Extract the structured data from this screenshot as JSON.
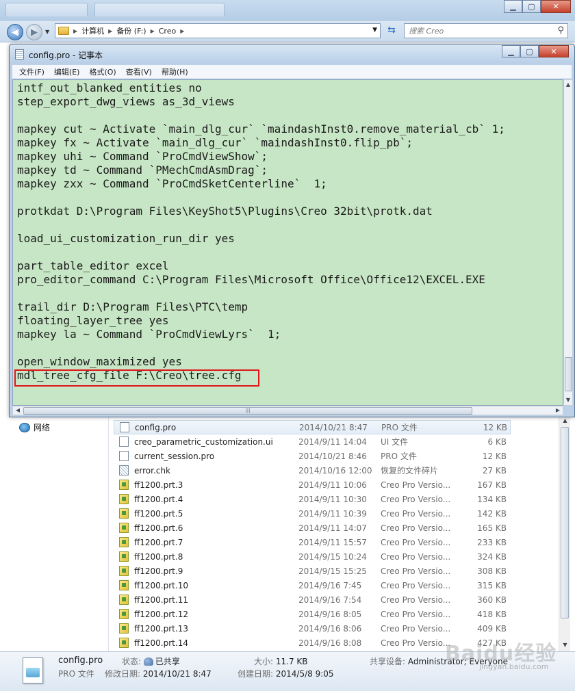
{
  "explorer": {
    "address": [
      "计算机",
      "备份 (F:)",
      "Creo"
    ],
    "search_placeholder": "搜索 Creo"
  },
  "notepad": {
    "title": "config.pro - 记事本",
    "menu": [
      "文件(F)",
      "编辑(E)",
      "格式(O)",
      "查看(V)",
      "帮助(H)"
    ],
    "content": "intf_out_blanked_entities no\nstep_export_dwg_views as_3d_views\n\nmapkey cut ~ Activate `main_dlg_cur` `maindashInst0.remove_material_cb` 1;\nmapkey fx ~ Activate `main_dlg_cur` `maindashInst0.flip_pb`;\nmapkey uhi ~ Command `ProCmdViewShow`;\nmapkey td ~ Command `PMechCmdAsmDrag`;\nmapkey zxx ~ Command `ProCmdSketCenterline`  1;\n\nprotkdat D:\\Program Files\\KeyShot5\\Plugins\\Creo 32bit\\protk.dat\n\nload_ui_customization_run_dir yes\n\npart_table_editor excel\npro_editor_command C:\\Program Files\\Microsoft Office\\Office12\\EXCEL.EXE\n\ntrail_dir D:\\Program Files\\PTC\\temp\nfloating_layer_tree yes\nmapkey la ~ Command `ProCmdViewLyrs`  1;\n\nopen_window_maximized yes\nmdl_tree_cfg_file F:\\Creo\\tree.cfg",
    "editor_bg": "#c7e6c5",
    "highlight_color": "#e0151a"
  },
  "nav": {
    "network": "网络"
  },
  "files": [
    {
      "name": "config.pro",
      "date": "2014/10/21 8:47",
      "type": "PRO 文件",
      "size": "12 KB",
      "icon": "document-icon",
      "selected": true
    },
    {
      "name": "creo_parametric_customization.ui",
      "date": "2014/9/11 14:04",
      "type": "UI 文件",
      "size": "6 KB",
      "icon": "document-icon"
    },
    {
      "name": "current_session.pro",
      "date": "2014/10/21 8:46",
      "type": "PRO 文件",
      "size": "12 KB",
      "icon": "document-icon"
    },
    {
      "name": "error.chk",
      "date": "2014/10/16 12:00",
      "type": "恢复的文件碎片",
      "size": "27 KB",
      "icon": "recovered-file-icon"
    },
    {
      "name": "ff1200.prt.3",
      "date": "2014/9/11 10:06",
      "type": "Creo Pro Versio...",
      "size": "167 KB",
      "icon": "part-file-icon"
    },
    {
      "name": "ff1200.prt.4",
      "date": "2014/9/11 10:30",
      "type": "Creo Pro Versio...",
      "size": "134 KB",
      "icon": "part-file-icon"
    },
    {
      "name": "ff1200.prt.5",
      "date": "2014/9/11 10:39",
      "type": "Creo Pro Versio...",
      "size": "142 KB",
      "icon": "part-file-icon"
    },
    {
      "name": "ff1200.prt.6",
      "date": "2014/9/11 14:07",
      "type": "Creo Pro Versio...",
      "size": "165 KB",
      "icon": "part-file-icon"
    },
    {
      "name": "ff1200.prt.7",
      "date": "2014/9/11 15:57",
      "type": "Creo Pro Versio...",
      "size": "233 KB",
      "icon": "part-file-icon"
    },
    {
      "name": "ff1200.prt.8",
      "date": "2014/9/15 10:24",
      "type": "Creo Pro Versio...",
      "size": "324 KB",
      "icon": "part-file-icon"
    },
    {
      "name": "ff1200.prt.9",
      "date": "2014/9/15 15:25",
      "type": "Creo Pro Versio...",
      "size": "308 KB",
      "icon": "part-file-icon"
    },
    {
      "name": "ff1200.prt.10",
      "date": "2014/9/16 7:45",
      "type": "Creo Pro Versio...",
      "size": "315 KB",
      "icon": "part-file-icon"
    },
    {
      "name": "ff1200.prt.11",
      "date": "2014/9/16 7:54",
      "type": "Creo Pro Versio...",
      "size": "360 KB",
      "icon": "part-file-icon"
    },
    {
      "name": "ff1200.prt.12",
      "date": "2014/9/16 8:05",
      "type": "Creo Pro Versio...",
      "size": "418 KB",
      "icon": "part-file-icon"
    },
    {
      "name": "ff1200.prt.13",
      "date": "2014/9/16 8:06",
      "type": "Creo Pro Versio...",
      "size": "409 KB",
      "icon": "part-file-icon"
    },
    {
      "name": "ff1200.prt.14",
      "date": "2014/9/16 8:08",
      "type": "Creo Pro Versio...",
      "size": "427 KB",
      "icon": "part-file-icon"
    }
  ],
  "details": {
    "name": "config.pro",
    "type": "PRO 文件",
    "status_label": "状态:",
    "status_value": "已共享",
    "modified_label": "修改日期:",
    "modified_value": "2014/10/21 8:47",
    "size_label": "大小:",
    "size_value": "11.7 KB",
    "created_label": "创建日期:",
    "created_value": "2014/5/8 9:05",
    "shared_label": "共享设备:",
    "shared_value": "Administrator; Everyone"
  },
  "watermark": {
    "brand": "Baidu经验",
    "url": "jingyan.baidu.com"
  }
}
